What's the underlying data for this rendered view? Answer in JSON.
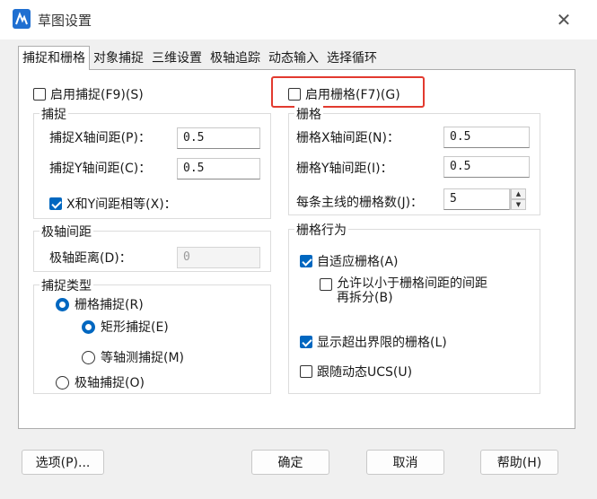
{
  "window": {
    "title": "草图设置",
    "close_glyph": "✕"
  },
  "tabs": [
    {
      "label": "捕捉和栅格",
      "active": true
    },
    {
      "label": "对象捕捉",
      "active": false
    },
    {
      "label": "三维设置",
      "active": false
    },
    {
      "label": "极轴追踪",
      "active": false
    },
    {
      "label": "动态输入",
      "active": false
    },
    {
      "label": "选择循环",
      "active": false
    }
  ],
  "snap": {
    "enable_label": "启用捕捉(F9)(S)",
    "enable_checked": false,
    "group_label": "捕捉",
    "x_label": "捕捉X轴间距(P)：",
    "x_value": "0.5",
    "y_label": "捕捉Y轴间距(C)：",
    "y_value": "0.5",
    "equal_label": "X和Y间距相等(X)：",
    "equal_checked": true
  },
  "polar": {
    "group_label": "极轴间距",
    "distance_label": "极轴距离(D)：",
    "distance_value": "0"
  },
  "snap_type": {
    "group_label": "捕捉类型",
    "grid_snap_label": "栅格捕捉(R)",
    "rect_snap_label": "矩形捕捉(E)",
    "iso_snap_label": "等轴测捕捉(M)",
    "polar_snap_label": "极轴捕捉(O)"
  },
  "grid": {
    "enable_label": "启用栅格(F7)(G)",
    "enable_checked": false,
    "group_label": "栅格",
    "x_label": "栅格X轴间距(N)：",
    "x_value": "0.5",
    "y_label": "栅格Y轴间距(I)：",
    "y_value": "0.5",
    "major_label": "每条主线的栅格数(J)：",
    "major_value": "5"
  },
  "grid_behavior": {
    "group_label": "栅格行为",
    "adaptive_label": "自适应栅格(A)",
    "adaptive_checked": true,
    "subdivide_line1": "允许以小于栅格间距的间距",
    "subdivide_line2": "再拆分(B)",
    "subdivide_checked": false,
    "beyond_label": "显示超出界限的栅格(L)",
    "beyond_checked": true,
    "follow_label": "跟随动态UCS(U)",
    "follow_checked": false
  },
  "footer": {
    "options_label": "选项(P)...",
    "ok_label": "确定",
    "cancel_label": "取消",
    "help_label": "帮助(H)"
  },
  "colors": {
    "accent": "#0067c0",
    "highlight": "#e23a2f"
  }
}
